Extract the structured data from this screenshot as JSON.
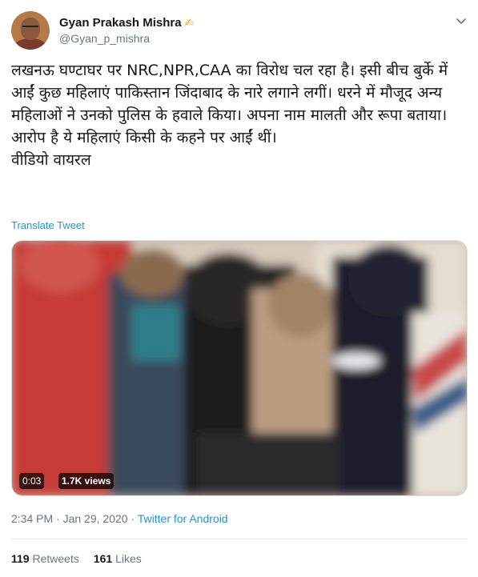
{
  "author": {
    "name": "Gyan Prakash Mishra",
    "handle": "@Gyan_p_mishra",
    "verified_icon": "pen-writing-icon"
  },
  "tweet": {
    "text": "लखनऊ घण्टाघर पर NRC,NPR,CAA का विरोध चल रहा है। इसी बीच बुर्के में आईं कुछ महिलाएं पाकिस्तान जिंदाबाद के नारे लगाने लगीं। धरने में मौजूद अन्य महिलाओं ने उनको पुलिस के हवाले किया। अपना नाम मालती और रूपा बताया। आरोप है ये महिलाएं किसी के कहने पर आईं थीं।\nवीडियो वायरल",
    "translate_label": "Translate Tweet"
  },
  "media": {
    "duration": "0:03",
    "views": "1.7K views"
  },
  "meta": {
    "time": "2:34 PM",
    "separator": "·",
    "date": "Jan 29, 2020",
    "source": "Twitter for Android"
  },
  "stats": {
    "retweets_count": "119",
    "retweets_label": "Retweets",
    "likes_count": "161",
    "likes_label": "Likes"
  },
  "colors": {
    "link": "#1b95e0",
    "secondary": "#657786",
    "primary": "#14171a"
  }
}
